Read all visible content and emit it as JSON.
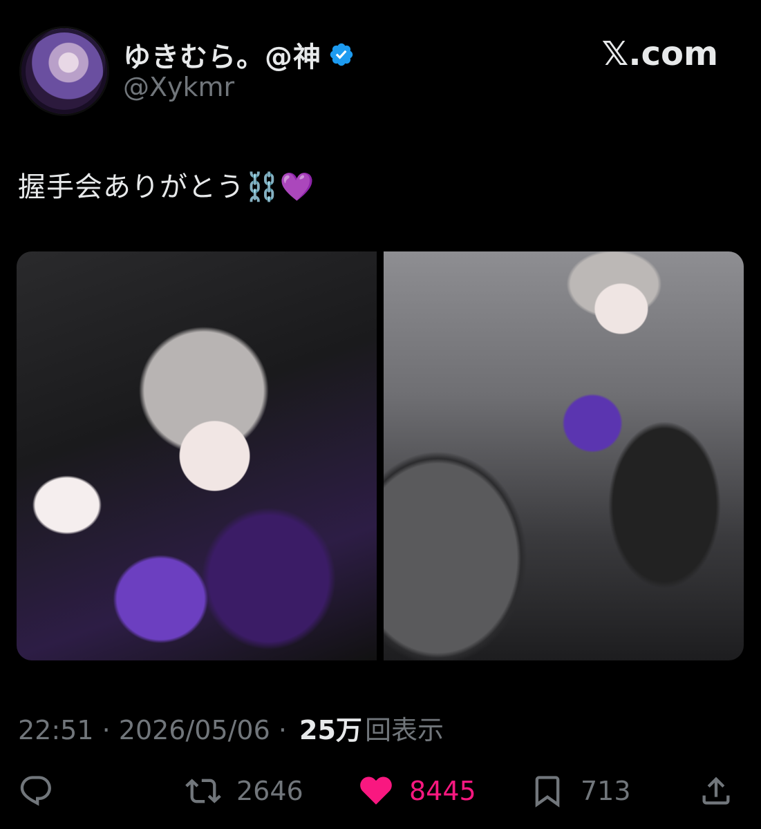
{
  "header": {
    "display_name": "ゆきむら。@神",
    "handle": "@Xykmr",
    "brand": "𝕏.com",
    "verified_color": "#1d9bf0"
  },
  "tweet": {
    "text": "握手会ありがとう⛓️💜"
  },
  "meta": {
    "time": "22:51",
    "date": "2026/05/06",
    "separator": " · ",
    "views_num": "25万",
    "views_label": "回表示"
  },
  "actions": {
    "reply_icon": "reply-icon",
    "retweets": "2646",
    "likes": "8445",
    "bookmarks": "713",
    "like_color": "#f91880"
  }
}
